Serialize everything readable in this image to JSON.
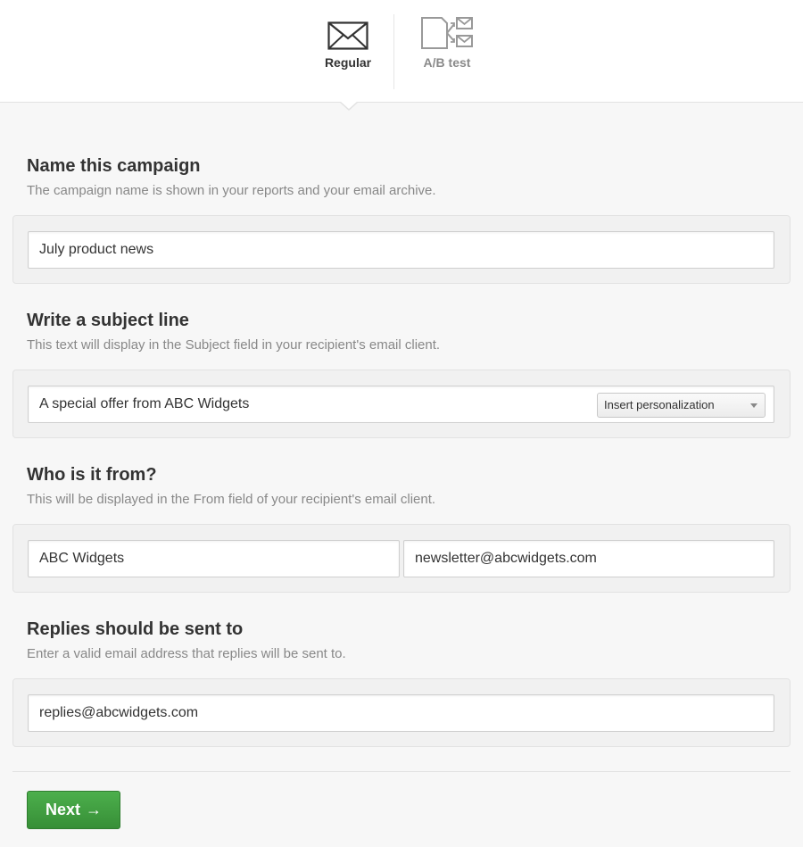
{
  "campaign_types": {
    "regular_label": "Regular",
    "abtest_label": "A/B test"
  },
  "sections": {
    "name": {
      "title": "Name this campaign",
      "description": "The campaign name is shown in your reports and your email archive.",
      "value": "July product news"
    },
    "subject": {
      "title": "Write a subject line",
      "description": "This text will display in the Subject field in your recipient's email client.",
      "value": "A special offer from ABC Widgets",
      "personalization_label": "Insert personalization"
    },
    "from": {
      "title": "Who is it from?",
      "description": "This will be displayed in the From field of your recipient's email client.",
      "name_value": "ABC Widgets",
      "email_value": "newsletter@abcwidgets.com"
    },
    "replies": {
      "title": "Replies should be sent to",
      "description": "Enter a valid email address that replies will be sent to.",
      "value": "replies@abcwidgets.com"
    }
  },
  "actions": {
    "next_label": "Next",
    "next_arrow": "→"
  },
  "colors": {
    "accent_green": "#3f9e3f",
    "inactive_tab": "#8a8a8a"
  },
  "icons": {
    "regular": "envelope-icon",
    "abtest": "ab-test-icon"
  }
}
